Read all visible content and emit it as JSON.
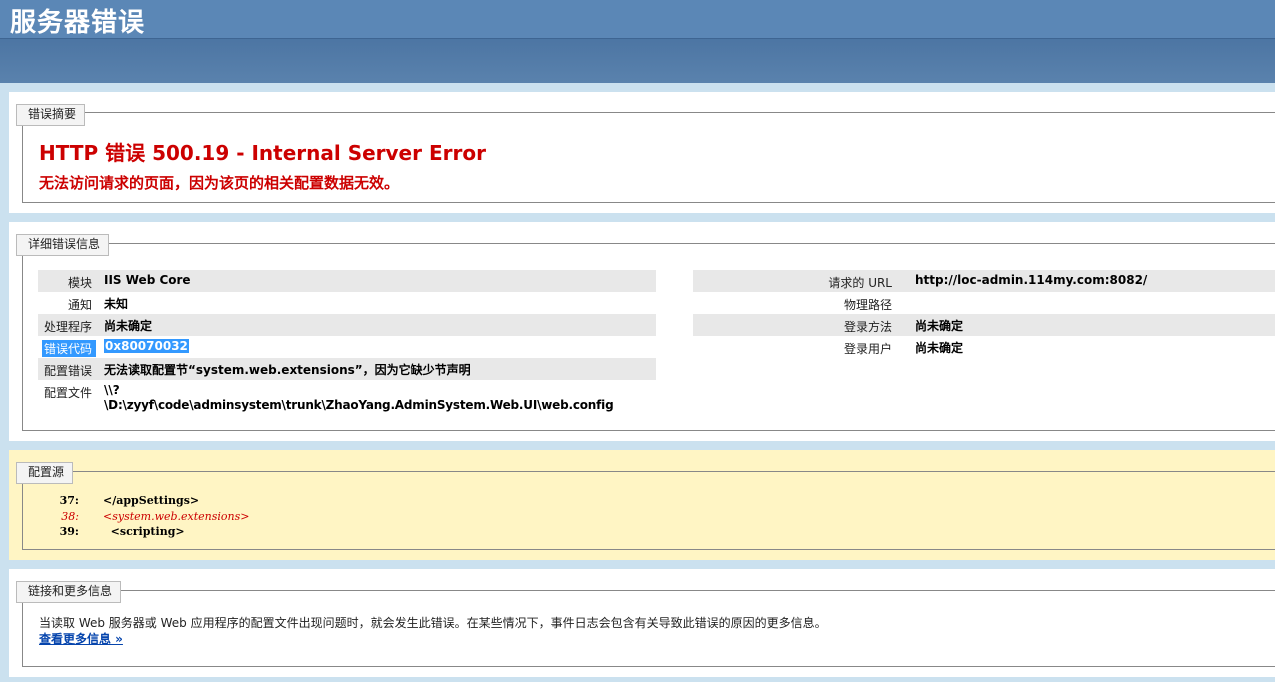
{
  "header": {
    "title": "服务器错误"
  },
  "summary": {
    "legend": "错误摘要",
    "title": "HTTP 错误 500.19 - Internal Server Error",
    "subtitle": "无法访问请求的页面，因为该页的相关配置数据无效。"
  },
  "detail": {
    "legend": "详细错误信息",
    "left": [
      {
        "label": "模块",
        "value": "IIS Web Core"
      },
      {
        "label": "通知",
        "value": "未知"
      },
      {
        "label": "处理程序",
        "value": "尚未确定"
      },
      {
        "label": "错误代码",
        "value": "0x80070032"
      },
      {
        "label": "配置错误",
        "value": "无法读取配置节“system.web.extensions”，因为它缺少节声明"
      },
      {
        "label": "配置文件",
        "value_line1": "\\\\?",
        "value_line2": "\\D:\\zyyf\\code\\adminsystem\\trunk\\ZhaoYang.AdminSystem.Web.UI\\web.config"
      }
    ],
    "right": [
      {
        "label": "请求的 URL",
        "value": "http://loc-admin.114my.com:8082/"
      },
      {
        "label": "物理路径",
        "value": ""
      },
      {
        "label": "登录方法",
        "value": "尚未确定"
      },
      {
        "label": "登录用户",
        "value": "尚未确定"
      }
    ]
  },
  "config_source": {
    "legend": "配置源",
    "lines": [
      {
        "num": "37:",
        "text": "</appSettings>"
      },
      {
        "num": "38:",
        "text": "<system.web.extensions>"
      },
      {
        "num": "39:",
        "text": "  <scripting>"
      }
    ]
  },
  "more_info": {
    "legend": "链接和更多信息",
    "text": "当读取 Web 服务器或 Web 应用程序的配置文件出现问题时，就会发生此错误。在某些情况下，事件日志会包含有关导致此错误的原因的更多信息。",
    "link": "查看更多信息 »"
  },
  "colors": {
    "header_bg": "#5b87b6",
    "error_red": "#cc0000",
    "config_bg": "#fff5c4",
    "selection": "#3399ff"
  }
}
